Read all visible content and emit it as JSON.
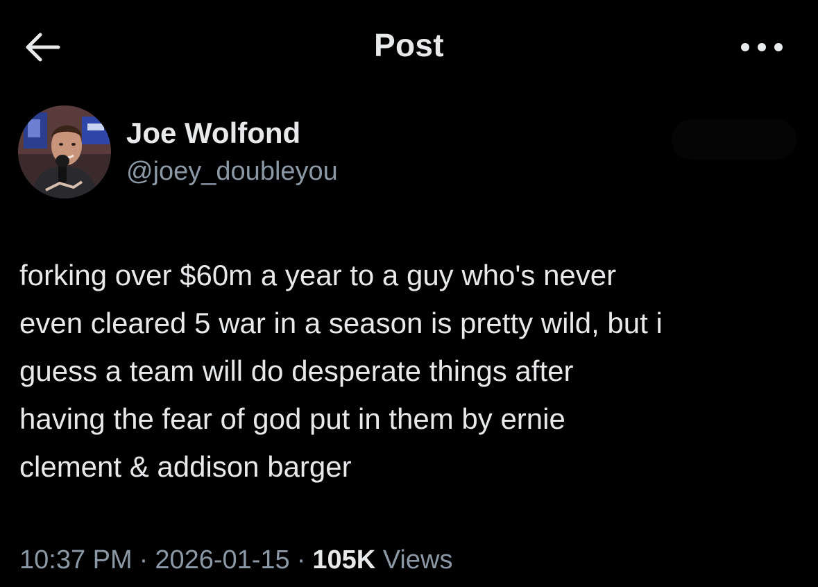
{
  "header": {
    "title": "Post",
    "back_icon": "arrow-left-icon",
    "more_icon": "ellipsis-horizontal-icon"
  },
  "author": {
    "display_name": "Joe Wolfond",
    "handle": "@joey_doubleyou",
    "avatar_icon": "avatar-photo"
  },
  "post": {
    "text": "forking over $60m a year to a guy who's never\neven cleared 5 war in a season is pretty wild, but i\nguess a team will do desperate things after\nhaving the fear of god put in them by ernie\nclement & addison barger"
  },
  "meta": {
    "time": "10:37 PM",
    "separator": "·",
    "date": "2026-01-15",
    "views_count": "105K",
    "views_label": "Views"
  },
  "colors": {
    "background": "#000000",
    "primary_text": "#e7e9ea",
    "secondary_text": "#8b98a5"
  }
}
